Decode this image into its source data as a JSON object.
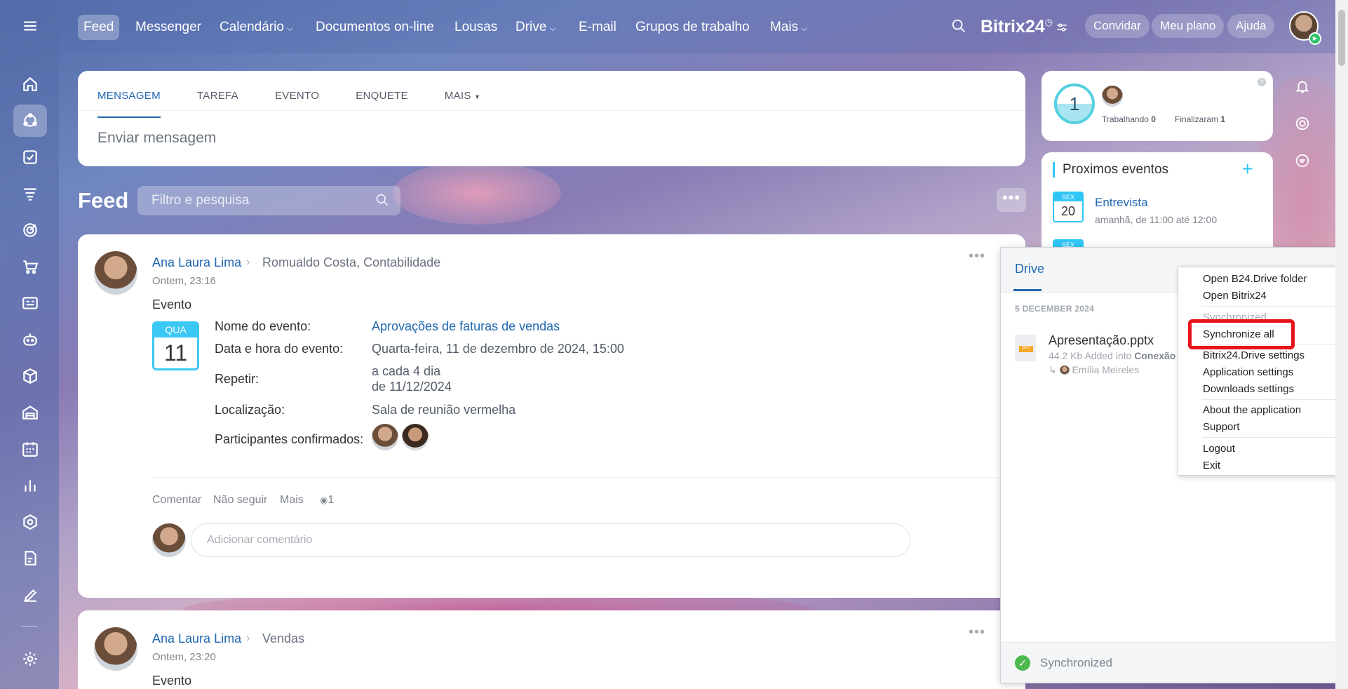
{
  "nav": {
    "items": [
      "Feed",
      "Messenger",
      "Calendário",
      "Documentos on-line",
      "Lousas",
      "Drive",
      "E-mail",
      "Grupos de trabalho",
      "Mais"
    ],
    "brand": "Bitrix24",
    "invite": "Convidar",
    "plan": "Meu plano",
    "help": "Ajuda"
  },
  "composer": {
    "tabs": [
      "MENSAGEM",
      "TAREFA",
      "EVENTO",
      "ENQUETE",
      "MAIS"
    ],
    "placeholder": "Enviar mensagem"
  },
  "feed": {
    "title": "Feed",
    "search_placeholder": "Filtro e pesquisa"
  },
  "post1": {
    "author": "Ana Laura Lima",
    "target": "Romualdo Costa, Contabilidade",
    "time": "Ontem, 23:16",
    "kind": "Evento",
    "badge_day": "QUA",
    "badge_num": "11",
    "fields": {
      "name_label": "Nome do evento:",
      "name_value": "Aprovações de faturas de vendas",
      "date_label": "Data e hora do evento:",
      "date_value": "Quarta-feira, 11 de dezembro de 2024, 15:00",
      "repeat_label": "Repetir:",
      "repeat_value1": "a cada 4 dia",
      "repeat_value2": "de 11/12/2024",
      "loc_label": "Localização:",
      "loc_value": "Sala de reunião vermelha",
      "part_label": "Participantes confirmados:"
    },
    "actions": {
      "comment": "Comentar",
      "unfollow": "Não seguir",
      "more": "Mais",
      "views": "1"
    },
    "comment_placeholder": "Adicionar comentário"
  },
  "post2": {
    "author": "Ana Laura Lima",
    "target": "Vendas",
    "time": "Ontem, 23:20",
    "kind": "Evento"
  },
  "status": {
    "count": "1",
    "working_label": "Trabalhando",
    "working_value": "0",
    "finished_label": "Finalizaram",
    "finished_value": "1"
  },
  "events": {
    "title": "Proximos eventos",
    "e1_day": "SEX",
    "e1_num": "20",
    "e1_title": "Entrevista",
    "e1_time": "amanhã, de 11:00 até 12:00",
    "e2_day": "SEX"
  },
  "drive": {
    "tab": "Drive",
    "date": "5 DECEMBER 2024",
    "file_name": "Apresentação.pptx",
    "file_size": "44.2 Kb",
    "file_action": "Added into",
    "file_folder": "Conexão",
    "file_user": "Emília Meireles",
    "footer": "Synchronized"
  },
  "menu": {
    "open_folder": "Open B24.Drive folder",
    "open_app": "Open Bitrix24",
    "synced": "Synchronized",
    "sync_all": "Synchronize all",
    "drive_settings": "Bitrix24.Drive settings",
    "app_settings": "Application settings",
    "dl_settings": "Downloads settings",
    "about": "About the application",
    "support": "Support",
    "logout": "Logout",
    "exit": "Exit"
  },
  "colors": {
    "accent": "#2067b0",
    "cyan": "#2fc6f6",
    "highlight": "#e8131b",
    "success": "#4cb94c"
  }
}
